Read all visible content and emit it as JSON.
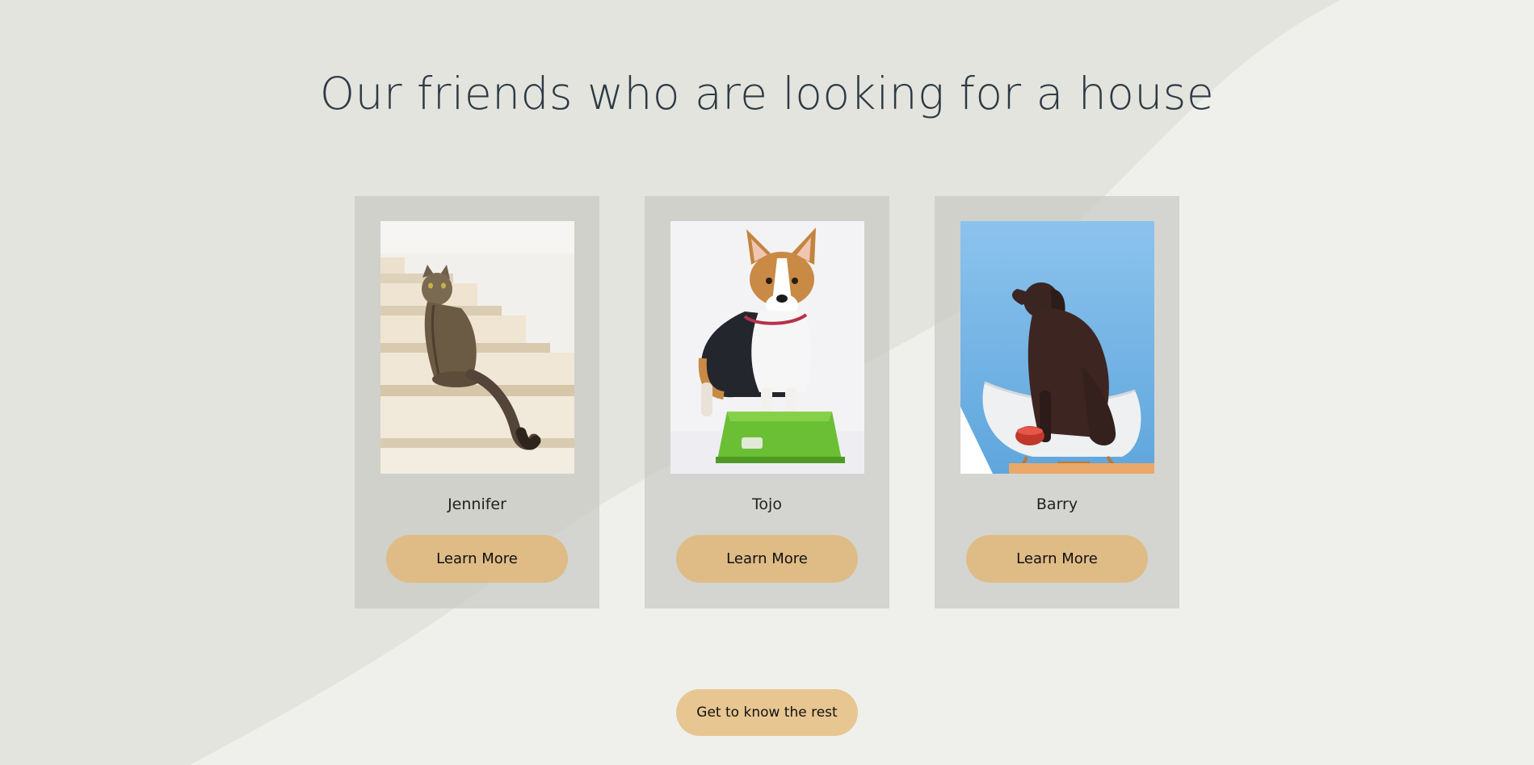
{
  "section": {
    "title": "Our friends who are looking for a house"
  },
  "pets": [
    {
      "name": "Jennifer",
      "button_label": "Learn More",
      "photo": "cat-on-stairs-photo"
    },
    {
      "name": "Tojo",
      "button_label": "Learn More",
      "photo": "corgi-on-green-stool-photo"
    },
    {
      "name": "Barry",
      "button_label": "Learn More",
      "photo": "brown-labrador-on-chair-photo"
    }
  ],
  "footer": {
    "cta_label": "Get to know the rest"
  },
  "colors": {
    "background": "#ecede8",
    "title": "#2d3a45",
    "card": "#d1d2cc",
    "button": "#dfbb86",
    "cta_button": "#e8c692"
  }
}
